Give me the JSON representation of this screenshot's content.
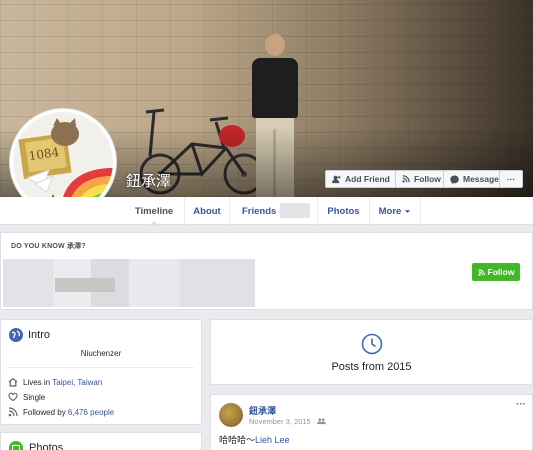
{
  "profile": {
    "name": "鈕承澤",
    "buttons": {
      "add_friend": "Add Friend",
      "follow": "Follow",
      "message": "Message",
      "more": "···"
    }
  },
  "tabs": [
    {
      "label": "Timeline"
    },
    {
      "label": "About"
    },
    {
      "label": "Friends"
    },
    {
      "label": "Photos"
    },
    {
      "label": "More"
    }
  ],
  "pymk": {
    "title": "DO YOU KNOW 承澤?",
    "follow": "Follow"
  },
  "intro": {
    "title": "Intro",
    "bio": "Niuchenzer",
    "lives_prefix": "Lives in",
    "lives_link": "Taipei, Taiwan",
    "relationship": "Single",
    "followed_prefix": "Followed by",
    "followed_link": "6,476 people"
  },
  "photos": {
    "title": "Photos"
  },
  "year_card": {
    "label": "Posts from 2015"
  },
  "post": {
    "author": "鈕承澤",
    "date": "November 3, 2015 · ",
    "text_prefix": "哈哈哈～",
    "tag": "Lieh Lee",
    "menu": "···"
  },
  "colors": {
    "link": "#365899",
    "green": "#42b72a",
    "bg": "#e9ebee"
  }
}
